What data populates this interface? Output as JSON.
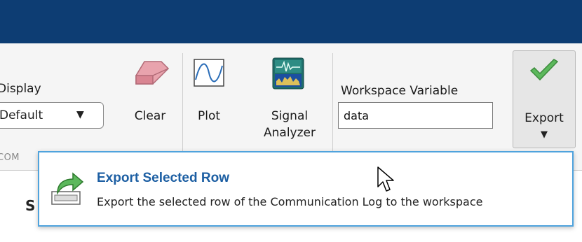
{
  "toolstrip": {
    "display": {
      "label": "Display",
      "selected_value": "Default",
      "arrow_icon": "caret-down-icon"
    },
    "clear": {
      "label": "Clear",
      "icon": "eraser-icon"
    },
    "plot": {
      "label": "Plot",
      "icon": "plot-icon"
    },
    "signal_analyzer": {
      "line1": "Signal",
      "line2": "Analyzer",
      "icon": "signal-analyzer-icon"
    },
    "workspace_variable": {
      "label": "Workspace Variable",
      "value": "data"
    },
    "export": {
      "label": "Export",
      "icon": "checkmark-icon",
      "arrow_icon": "caret-down-icon"
    },
    "section_label": "COM"
  },
  "popup": {
    "title": "Export Selected Row",
    "description": "Export the selected row of the Communication Log to the workspace",
    "icon": "export-row-icon"
  },
  "table": {
    "partial_header": "S"
  },
  "colors": {
    "title_bar": "#0d3d73",
    "popup_border": "#4fa3dd",
    "popup_title": "#1d5fa3",
    "check_green": "#5cb85c"
  }
}
